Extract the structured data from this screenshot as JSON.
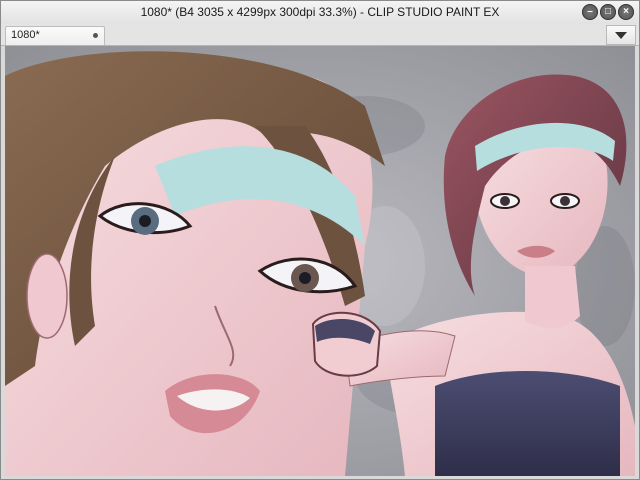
{
  "window": {
    "title": "1080* (B4 3035 x 4299px 300dpi 33.3%)  - CLIP STUDIO PAINT EX"
  },
  "titlebar_buttons": {
    "minimize_glyph": "–",
    "maximize_glyph": "□",
    "close_glyph": "×"
  },
  "tab": {
    "label": "1080*",
    "modified_indicator": "dot-icon"
  },
  "tab_menu": {
    "icon": "triangle-down-icon"
  },
  "canvas": {
    "content": "illustration-artwork"
  }
}
